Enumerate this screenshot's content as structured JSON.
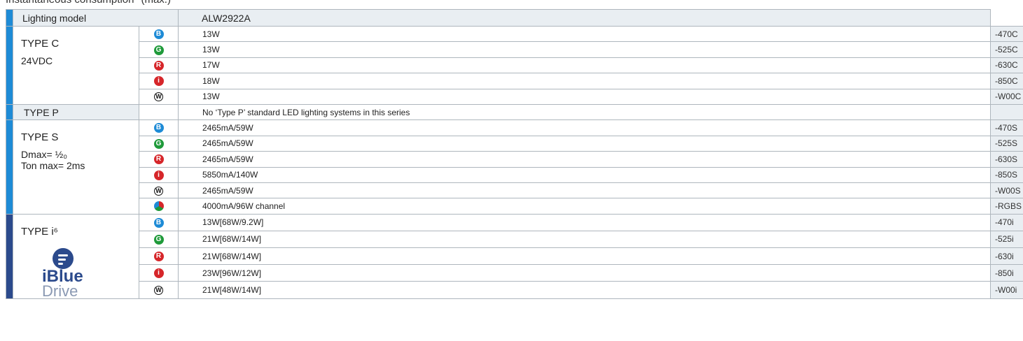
{
  "caption": "Instantaneous consumption* (max.)",
  "header": {
    "label": "Lighting model",
    "model": "ALW2922A"
  },
  "groups": {
    "type_c": {
      "title": "TYPE C",
      "sub": "24VDC",
      "rows": [
        {
          "icon": "blue-b-icon",
          "letter": "B",
          "value": "13W",
          "code": "-470C"
        },
        {
          "icon": "green-g-icon",
          "letter": "G",
          "value": "13W",
          "code": "-525C"
        },
        {
          "icon": "red-r-icon",
          "letter": "R",
          "value": "17W",
          "code": "-630C"
        },
        {
          "icon": "red-i-icon",
          "letter": "i",
          "value": "18W",
          "code": "-850C"
        },
        {
          "icon": "white-w-icon",
          "letter": "W",
          "value": "13W",
          "code": "-W00C"
        }
      ]
    },
    "type_p": {
      "title": "TYPE P",
      "note": "No ‘Type P’ standard LED lighting systems in this series"
    },
    "type_s": {
      "title": "TYPE S",
      "sub1": "Dmax= ½₀",
      "sub2": "Ton max= 2ms",
      "rows": [
        {
          "icon": "blue-b-icon",
          "letter": "B",
          "value": "2465mA/59W",
          "code": "-470S"
        },
        {
          "icon": "green-g-icon",
          "letter": "G",
          "value": "2465mA/59W",
          "code": "-525S"
        },
        {
          "icon": "red-r-icon",
          "letter": "R",
          "value": "2465mA/59W",
          "code": "-630S"
        },
        {
          "icon": "red-i-icon",
          "letter": "i",
          "value": "5850mA/140W",
          "code": "-850S"
        },
        {
          "icon": "white-w-icon",
          "letter": "W",
          "value": "2465mA/59W",
          "code": "-W00S"
        },
        {
          "icon": "rgb-icon",
          "letter": "",
          "value": "4000mA/96W channel",
          "code": "-RGBS"
        }
      ]
    },
    "type_i": {
      "title": "TYPE i⁶",
      "brand1": "iBlue",
      "brand2": "Drive",
      "rows": [
        {
          "icon": "blue-b-icon",
          "letter": "B",
          "value": "13W[68W/9.2W]",
          "code": "-470i"
        },
        {
          "icon": "green-g-icon",
          "letter": "G",
          "value": "21W[68W/14W]",
          "code": "-525i"
        },
        {
          "icon": "red-r-icon",
          "letter": "R",
          "value": "21W[68W/14W]",
          "code": "-630i"
        },
        {
          "icon": "red-i-icon",
          "letter": "i",
          "value": "23W[96W/12W]",
          "code": "-850i"
        },
        {
          "icon": "white-w-icon",
          "letter": "W",
          "value": "21W[48W/14W]",
          "code": "-W00i"
        }
      ]
    }
  },
  "colors": {
    "light_blue_bar": "#1e8bd6",
    "dark_blue_bar": "#2b4a8c",
    "header_bg": "#e9eef2"
  }
}
